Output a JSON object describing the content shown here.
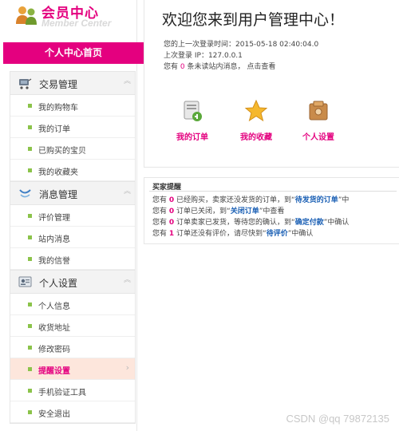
{
  "brand": {
    "title": "会员中心",
    "subtitle": "Member Center"
  },
  "home_tab": "个人中心首页",
  "menu": [
    {
      "label": "交易管理",
      "icon": "cart-icon",
      "items": [
        {
          "label": "我的购物车"
        },
        {
          "label": "我的订单"
        },
        {
          "label": "已购买的宝贝"
        },
        {
          "label": "我的收藏夹"
        }
      ]
    },
    {
      "label": "消息管理",
      "icon": "message-icon",
      "items": [
        {
          "label": "评价管理"
        },
        {
          "label": "站内消息"
        },
        {
          "label": "我的信誉"
        }
      ]
    },
    {
      "label": "个人设置",
      "icon": "profile-card-icon",
      "items": [
        {
          "label": "个人信息"
        },
        {
          "label": "收货地址"
        },
        {
          "label": "修改密码"
        },
        {
          "label": "提醒设置",
          "active": true
        },
        {
          "label": "手机验证工具"
        },
        {
          "label": "安全退出"
        }
      ]
    }
  ],
  "welcome": {
    "title": "欢迎您来到用户管理中心！",
    "last_login_label": "您的上一次登录时间：",
    "last_login_time": "2015-05-18 02:40:04.0",
    "last_ip_label": "上次登录 IP：",
    "last_ip": "127.0.0.1",
    "msg_prefix": "您有",
    "msg_count": "0",
    "msg_suffix": "条未读站内消息，",
    "msg_link": "点击查看"
  },
  "shortcuts": [
    {
      "label": "我的订单",
      "icon": "order-icon"
    },
    {
      "label": "我的收藏",
      "icon": "star-icon"
    },
    {
      "label": "个人设置",
      "icon": "settings-box-icon"
    }
  ],
  "reminder": {
    "title": "买家提醒",
    "rows": [
      {
        "pre": "您有",
        "count": "0",
        "mid": "已经购买，卖家还没发货的订单，到“",
        "link": "待发货的订单",
        "post": "”中"
      },
      {
        "pre": "您有",
        "count": "0",
        "mid": "订单已关闭，到“",
        "link": "关闭订单",
        "post": "”中查看"
      },
      {
        "pre": "您有",
        "count": "0",
        "mid": "订单卖家已发货，等待您的确认，到“",
        "link": "确定付款",
        "post": "”中确认"
      },
      {
        "pre": "您有",
        "count": "1",
        "mid": "订单还没有评价，请尽快到“",
        "link": "待评价",
        "post": "”中确认"
      }
    ]
  },
  "watermark": "CSDN @qq 79872135",
  "colors": {
    "accent": "#e4007f",
    "link": "#1a5fb4",
    "bullet": "#8bc34a"
  }
}
